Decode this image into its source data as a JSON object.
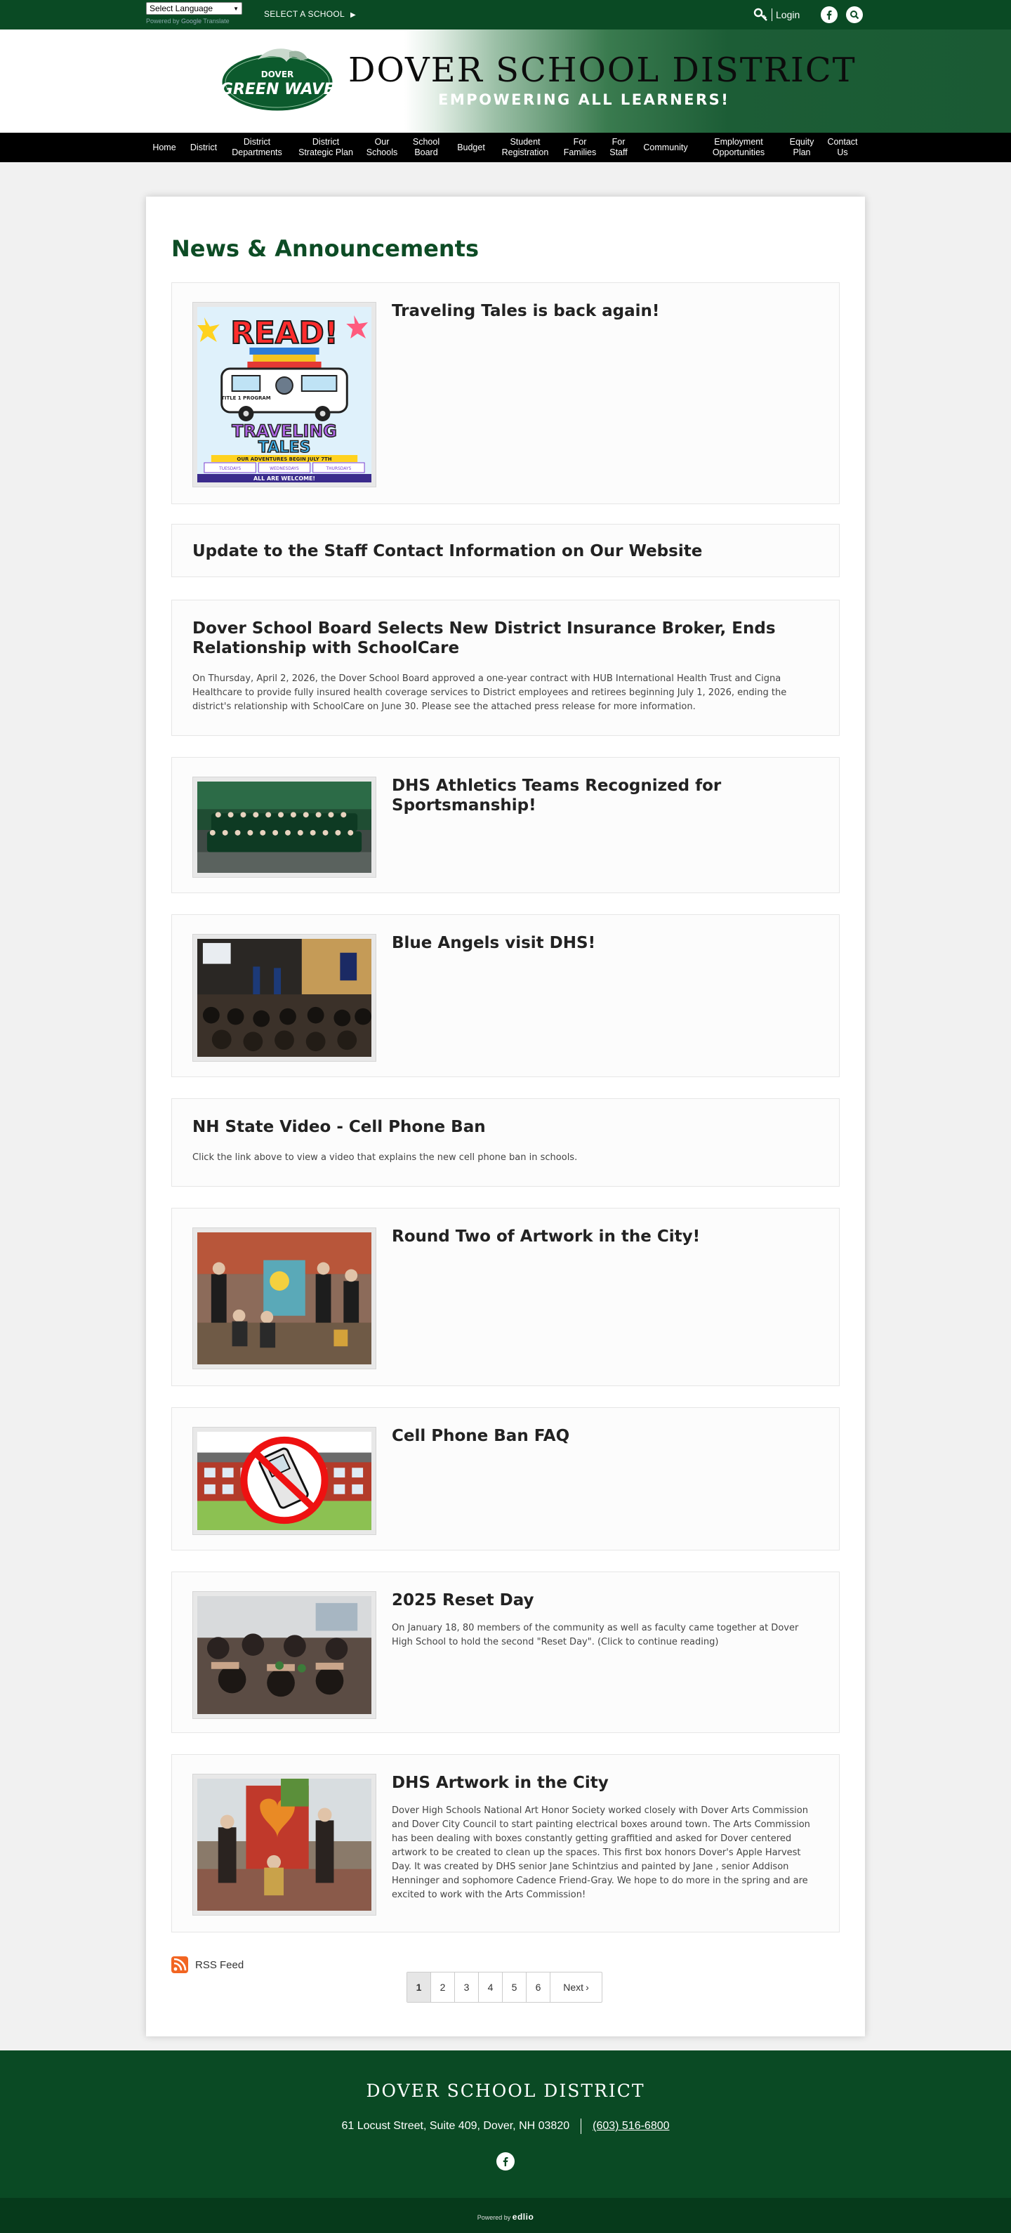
{
  "topbar": {
    "language_select": "Select Language",
    "powered_by": "Powered by",
    "google_word": "Google",
    "translate_word": "Translate",
    "select_school": "SELECT A SCHOOL",
    "login": "Login",
    "icons": [
      "key-icon",
      "facebook-icon",
      "search-icon"
    ]
  },
  "header": {
    "logo_line1": "DOVER",
    "logo_line2": "GREEN WAVE",
    "title": "DOVER SCHOOL DISTRICT",
    "tagline": "EMPOWERING ALL LEARNERS!"
  },
  "nav": {
    "items": [
      "Home",
      "District",
      "District\nDepartments",
      "District\nStrategic Plan",
      "Our\nSchools",
      "School\nBoard",
      "Budget",
      "Student\nRegistration",
      "For\nFamilies",
      "For\nStaff",
      "Community",
      "Employment\nOpportunities",
      "Equity\nPlan",
      "Contact\nUs"
    ]
  },
  "news": {
    "heading": "News & Announcements",
    "items": [
      {
        "title": "Traveling Tales is back again!",
        "body": ""
      },
      {
        "title": "Update to the Staff Contact Information on Our Website",
        "body": ""
      },
      {
        "title": "Dover School Board Selects New District Insurance Broker, Ends Relationship with SchoolCare",
        "body": "On Thursday, April 2, 2026, the Dover School Board approved a one-year contract with HUB International Health Trust and Cigna Healthcare to provide fully insured health coverage services to District employees and retirees beginning July 1, 2026, ending the district's relationship with SchoolCare on June 30. Please see the attached press release for more information."
      },
      {
        "title": "DHS Athletics Teams Recognized for Sportsmanship!",
        "body": ""
      },
      {
        "title": "Blue Angels visit DHS!",
        "body": ""
      },
      {
        "title": "NH State Video - Cell Phone Ban",
        "body": "Click the link above to view a video that explains the new cell phone ban in schools."
      },
      {
        "title": "Round Two of Artwork in the City!",
        "body": ""
      },
      {
        "title": "Cell Phone Ban FAQ",
        "body": ""
      },
      {
        "title": "2025 Reset Day",
        "body": "On January 18, 80 members of the community as well as faculty came together at Dover High School to hold the second \"Reset Day\". (Click to continue reading)"
      },
      {
        "title": "DHS Artwork in the City",
        "body": "Dover High Schools National Art Honor Society worked closely with Dover Arts Commission and Dover City Council to start painting electrical boxes around town. The Arts Commission has been dealing with boxes constantly getting graffitied and asked for Dover centered artwork to be created to clean up the spaces. This first box honors Dover's Apple Harvest Day. It was created by DHS senior Jane Schintzius and painted by Jane , senior Addison Henninger and sophomore Cadence Friend-Gray. We hope to do more in the spring and are excited to work with the Arts Commission!"
      }
    ],
    "flyer": {
      "read": "READ!",
      "title1": "TRAVELING",
      "title2": "TALES",
      "banner": "OUR ADVENTURES BEGIN JULY 7TH",
      "footer": "ALL ARE WELCOME!",
      "van_label": "TITLE 1\nPROGRAM",
      "days": [
        "TUESDAYS",
        "WEDNESDAYS",
        "THURSDAYS"
      ]
    }
  },
  "rss": {
    "label": "RSS Feed"
  },
  "pagination": {
    "pages": [
      "1",
      "2",
      "3",
      "4",
      "5",
      "6"
    ],
    "next": "Next",
    "current": "1"
  },
  "footer": {
    "title": "DOVER SCHOOL DISTRICT",
    "address": "61 Locust Street, Suite 409, Dover, NH 03820",
    "phone": "(603) 516-6800",
    "powered_by": "Powered by",
    "brand": "edlio"
  },
  "colors": {
    "brand_green": "#0a4a24",
    "heading_green": "#0d4c25",
    "nav_black": "#000000",
    "rss_orange": "#f26522"
  }
}
